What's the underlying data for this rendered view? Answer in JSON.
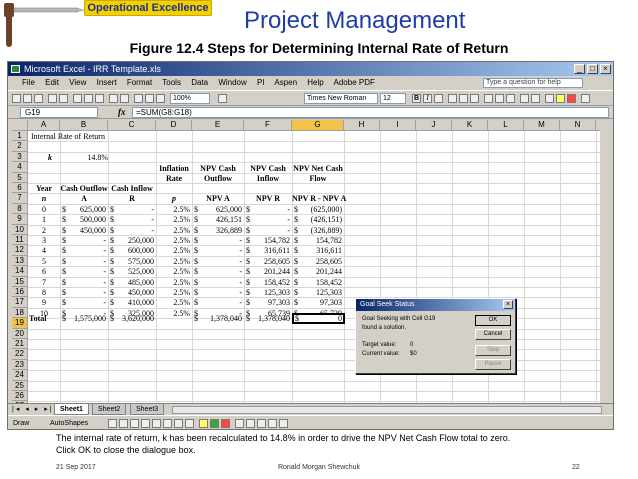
{
  "slide": {
    "brand": "Operational Excellence",
    "title": "Project Management",
    "figure_title": "Figure 12.4  Steps for Determining Internal Rate of Return",
    "caption_line1": "The internal rate of return, k has been recalculated to 14.8% in order to drive the NPV Net Cash Flow total to zero.",
    "caption_line2": "Click OK to close the dialogue box.",
    "footer_date": "21 Sep 2017",
    "footer_author": "Ronald Morgan Shewchuk",
    "footer_page": "22"
  },
  "excel": {
    "window_title": "Microsoft Excel - IRR Template.xls",
    "window_buttons": [
      "_",
      "□",
      "×"
    ],
    "menu": [
      "File",
      "Edit",
      "View",
      "Insert",
      "Format",
      "Tools",
      "Data",
      "Window",
      "PI",
      "Aspen",
      "Help",
      "Adobe PDF"
    ],
    "type_question": "Type a question for help",
    "zoom": "100%",
    "font_name": "Times New Roman",
    "font_size": "12",
    "name_box": "G19",
    "fx": "fx",
    "formula": "=SUM(G8:G18)",
    "columns": [
      "A",
      "B",
      "C",
      "D",
      "E",
      "F",
      "G",
      "H",
      "I",
      "J",
      "K",
      "L",
      "M",
      "N",
      "O"
    ],
    "row_numbers": [
      "1",
      "2",
      "3",
      "4",
      "5",
      "6",
      "7",
      "8",
      "9",
      "10",
      "11",
      "12",
      "13",
      "14",
      "15",
      "16",
      "17",
      "18",
      "19",
      "20",
      "21",
      "22",
      "23",
      "24",
      "25",
      "26",
      "27",
      "28"
    ],
    "sheet_tabs": [
      "Sheet1",
      "Sheet2",
      "Sheet3"
    ],
    "draw_label": "Draw",
    "autoshapes_label": "AutoShapes"
  },
  "sheet": {
    "a1": "Internal Rate of Return",
    "k_label": "k",
    "k_value": "14.8%",
    "headers": {
      "year": "Year",
      "cash_outflow": "Cash Outflow",
      "cash_inflow": "Cash Inflow",
      "inflation_1": "Inflation",
      "inflation_2": "Rate",
      "npv_cash_outflow_1": "NPV Cash",
      "npv_cash_outflow_2": "Outflow",
      "npv_cash_inflow_1": "NPV Cash",
      "npv_cash_inflow_2": "Inflow",
      "npv_net_1": "NPV Net Cash",
      "npv_net_2": "Flow"
    },
    "symbols": {
      "n": "n",
      "a": "A",
      "r": "R",
      "p": "p",
      "npv_a": "NPV A",
      "npv_r": "NPV R",
      "npv_ra": "NPV R - NPV A"
    },
    "rows": [
      {
        "n": "0",
        "a": "625,000",
        "r": "-",
        "p": "2.5%",
        "npva": "625,000",
        "npvr": "-",
        "net": "(625,000)"
      },
      {
        "n": "1",
        "a": "500,000",
        "r": "-",
        "p": "2.5%",
        "npva": "426,151",
        "npvr": "-",
        "net": "(426,151)"
      },
      {
        "n": "2",
        "a": "450,000",
        "r": "-",
        "p": "2.5%",
        "npva": "326,889",
        "npvr": "-",
        "net": "(326,889)"
      },
      {
        "n": "3",
        "a": "-",
        "r": "250,000",
        "p": "2.5%",
        "npva": "-",
        "npvr": "154,782",
        "net": "154,782"
      },
      {
        "n": "4",
        "a": "-",
        "r": "600,000",
        "p": "2.5%",
        "npva": "-",
        "npvr": "316,611",
        "net": "316,611"
      },
      {
        "n": "5",
        "a": "-",
        "r": "575,000",
        "p": "2.5%",
        "npva": "-",
        "npvr": "258,605",
        "net": "258,605"
      },
      {
        "n": "6",
        "a": "-",
        "r": "525,000",
        "p": "2.5%",
        "npva": "-",
        "npvr": "201,244",
        "net": "201,244"
      },
      {
        "n": "7",
        "a": "-",
        "r": "485,000",
        "p": "2.5%",
        "npva": "-",
        "npvr": "158,452",
        "net": "158,452"
      },
      {
        "n": "8",
        "a": "-",
        "r": "450,000",
        "p": "2.5%",
        "npva": "-",
        "npvr": "125,303",
        "net": "125,303"
      },
      {
        "n": "9",
        "a": "-",
        "r": "410,000",
        "p": "2.5%",
        "npva": "-",
        "npvr": "97,303",
        "net": "97,303"
      },
      {
        "n": "10",
        "a": "-",
        "r": "325,000",
        "p": "2.5%",
        "npva": "-",
        "npvr": "65,739",
        "net": "65,739"
      }
    ],
    "total": {
      "label": "Total",
      "a": "1,575,000",
      "r": "3,620,000",
      "npva": "1,378,040",
      "npvr": "1,378,040",
      "net": "0"
    },
    "dollar": "$"
  },
  "dialog": {
    "title": "Goal Seek Status",
    "close": "×",
    "line1": "Goal Seeking with Cell G19",
    "line2": "found a solution.",
    "target_label": "Target value:",
    "target_value": "0",
    "current_label": "Current value:",
    "current_value": "$0",
    "ok": "OK",
    "cancel": "Cancel",
    "step": "Step",
    "pause": "Pause"
  }
}
